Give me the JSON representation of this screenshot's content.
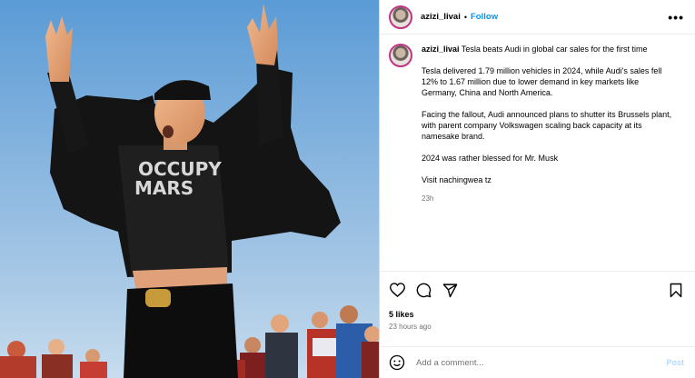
{
  "post": {
    "username": "azizi_livai",
    "follow_label": "Follow",
    "more_label": "•••",
    "caption": {
      "username": "azizi_livai",
      "title": "Tesla beats Audi in global car sales for the first time",
      "paragraphs": [
        "Tesla delivered 1.79 million vehicles in 2024, while Audi's sales fell 12% to 1.67 million due to lower demand in key markets like Germany, China and North America.",
        "Facing the fallout, Audi announced plans to shutter its Brussels plant, with parent company Volkswagen scaling back capacity at its namesake brand.",
        "2024 was rather blessed for Mr. Musk",
        "Visit nachingwea tz"
      ],
      "age": "23h"
    },
    "likes": "5 likes",
    "posted_time": "23 hours ago",
    "comment_placeholder": "Add a comment...",
    "post_label": "Post",
    "photo": {
      "shirt_text_line1": "OCCUPY",
      "shirt_text_line2": "MARS"
    },
    "icons": {
      "like": "heart-icon",
      "comment": "comment-icon",
      "share": "share-icon",
      "save": "bookmark-icon",
      "emoji": "emoji-icon"
    },
    "colors": {
      "follow": "#0095f6",
      "sky_top": "#5b9bd6",
      "sky_bottom": "#c7dcee",
      "secondary_text": "#737373"
    }
  }
}
